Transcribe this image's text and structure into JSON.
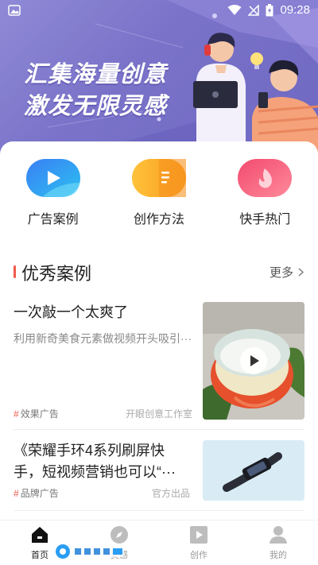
{
  "status_bar": {
    "time": "09:28"
  },
  "hero": {
    "line1": "汇集海量创意",
    "line2": "激发无限灵感",
    "colors": {
      "bg_start": "#8f8ad6",
      "bg_end": "#6f68c2"
    }
  },
  "quick_entries": [
    {
      "label": "广告案例",
      "icon": "play-icon",
      "color": "#2a8cf0"
    },
    {
      "label": "创作方法",
      "icon": "document-icon",
      "color": "#f7a52a"
    },
    {
      "label": "快手热门",
      "icon": "flame-icon",
      "color": "#f0436b"
    }
  ],
  "section": {
    "title": "优秀案例",
    "more": "更多"
  },
  "cards": [
    {
      "title": "一次敲一个太爽了",
      "desc": "利用新奇美食元素做视频开头吸引···",
      "tag": "效果广告",
      "source": "开眼创意工作室"
    },
    {
      "title_line1": "《荣耀手环4系列刷屏快",
      "title_line2": "手，短视频营销也可以“···",
      "tag": "品牌广告",
      "source": "官方出品"
    }
  ],
  "bottom_nav": [
    {
      "label": "首页",
      "icon": "home-icon",
      "active": true
    },
    {
      "label": "灵感",
      "icon": "compass-icon",
      "active": false
    },
    {
      "label": "创作",
      "icon": "video-icon",
      "active": false
    },
    {
      "label": "我的",
      "icon": "user-icon",
      "active": false
    }
  ],
  "accent": "#f05a4a"
}
